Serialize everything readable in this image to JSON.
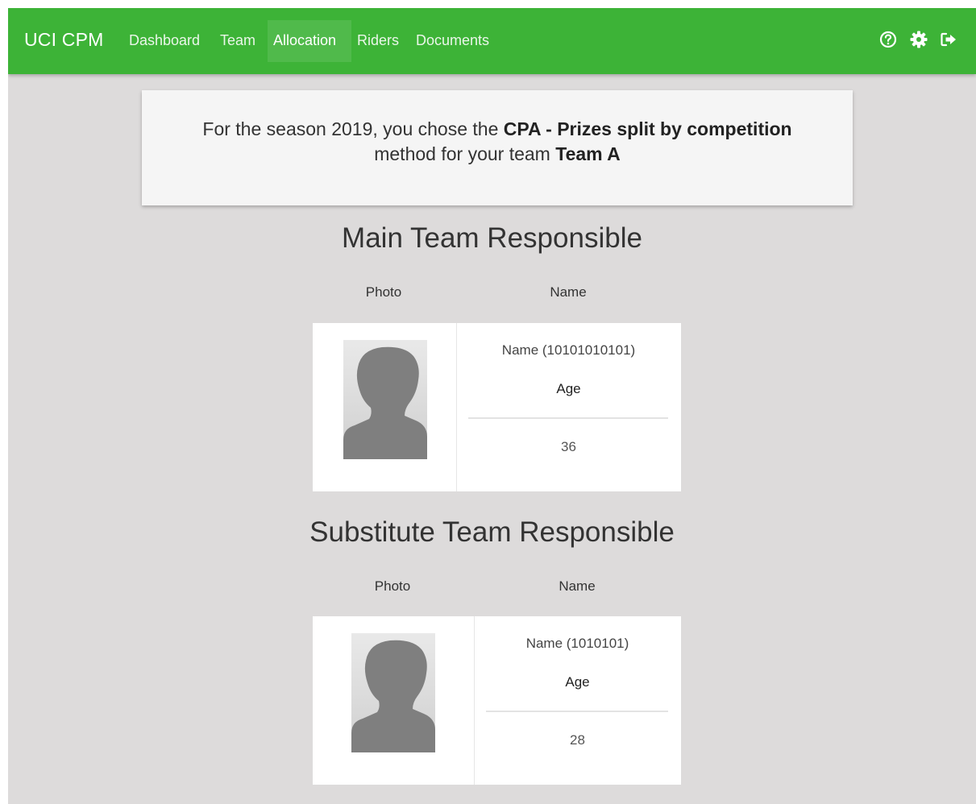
{
  "nav": {
    "brand": "UCI CPM",
    "items": [
      {
        "label": "Dashboard",
        "active": false
      },
      {
        "label": "Team",
        "active": false
      },
      {
        "label": "Allocation",
        "active": true
      },
      {
        "label": "Riders",
        "active": false
      },
      {
        "label": "Documents",
        "active": false
      }
    ],
    "icons": [
      "help-icon",
      "settings-icon",
      "logout-icon"
    ]
  },
  "info": {
    "prefix": "For the season 2019, you chose the",
    "method": "CPA - Prizes split by competition",
    "middle": "method for your team",
    "team": "Team A"
  },
  "main_responsible": {
    "title": "Main Team Responsible",
    "col_photo": "Photo",
    "col_name": "Name",
    "name": "Name (10101010101)",
    "age_label": "Age",
    "age": "36"
  },
  "substitute_responsible": {
    "title": "Substitute Team Responsible",
    "col_photo": "Photo",
    "col_name": "Name",
    "name": "Name (1010101)",
    "age_label": "Age",
    "age": "28"
  },
  "colors": {
    "navbar": "#3db337",
    "background": "#dddbdb",
    "avatar": "#7f7f7f"
  }
}
